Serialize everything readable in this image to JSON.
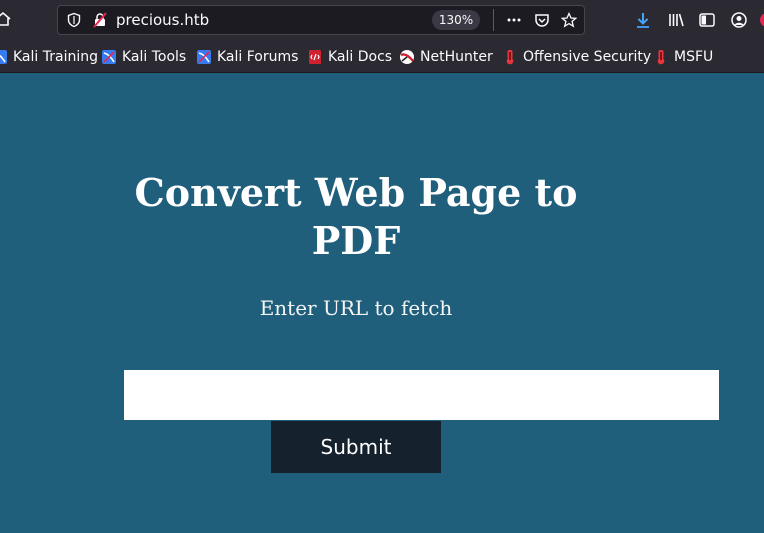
{
  "browser": {
    "url": "precious.htb",
    "zoom": "130%",
    "accent_color": "#1f5f7c"
  },
  "bookmarks": [
    {
      "label": "Kali Training",
      "icon": "kali-icon"
    },
    {
      "label": "Kali Tools",
      "icon": "kali-icon"
    },
    {
      "label": "Kali Forums",
      "icon": "kali-icon"
    },
    {
      "label": "Kali Docs",
      "icon": "kali-docs-icon"
    },
    {
      "label": "NetHunter",
      "icon": "nethunter-icon"
    },
    {
      "label": "Offensive Security",
      "icon": "offsec-icon"
    },
    {
      "label": "MSFU",
      "icon": "offsec-icon"
    }
  ],
  "page": {
    "heading": "Convert Web Page to PDF",
    "label": "Enter URL to fetch",
    "input_value": "",
    "submit_label": "Submit",
    "background_color": "#1f5f7c",
    "button_color": "#15222e"
  }
}
